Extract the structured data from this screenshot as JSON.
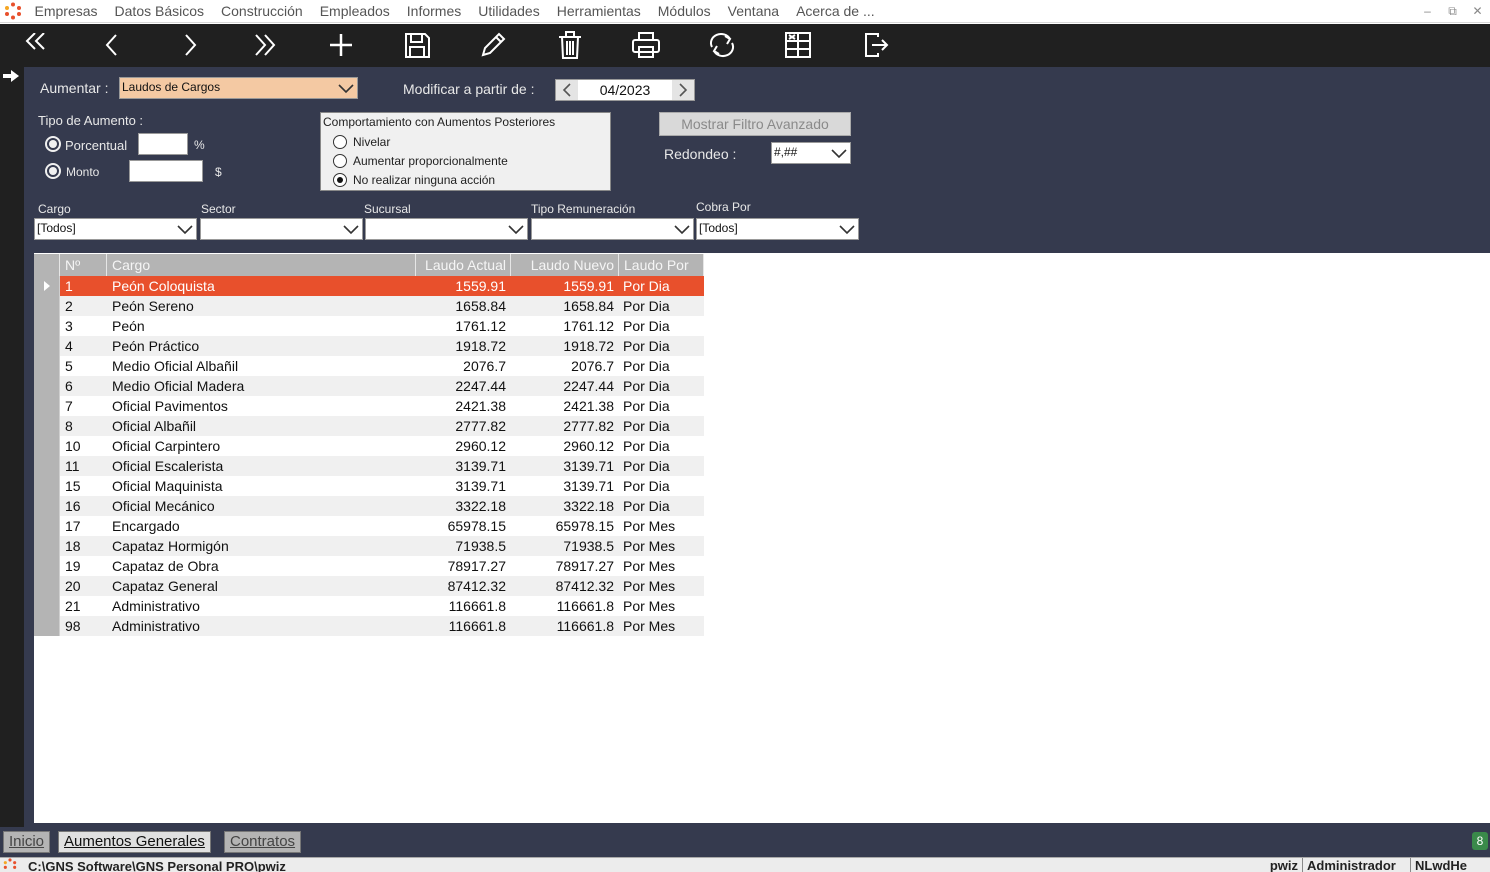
{
  "menu": {
    "items": [
      "Empresas",
      "Datos Básicos",
      "Construcción",
      "Empleados",
      "Informes",
      "Utilidades",
      "Herramientas",
      "Módulos",
      "Ventana",
      "Acerca de ..."
    ]
  },
  "toolbar": {
    "buttons": [
      "first-icon",
      "prev-icon",
      "next-icon",
      "last-icon",
      "add-icon",
      "save-icon",
      "edit-icon",
      "delete-icon",
      "print-icon",
      "refresh-icon",
      "excel-icon",
      "exit-icon"
    ]
  },
  "filters": {
    "aumentar_label": "Aumentar :",
    "aumentar_value": "Laudos de Cargos",
    "modificar_label": "Modificar a partir de :",
    "modificar_value": "04/2023",
    "tipo_label": "Tipo de Aumento :",
    "porcentual_label": "Porcentual",
    "porcentual_unit": "%",
    "monto_label": "Monto",
    "monto_unit": "$",
    "comportamiento_title": "Comportamiento con Aumentos Posteriores",
    "comportamiento_options": [
      "Nivelar",
      "Aumentar proporcionalmente",
      "No realizar ninguna acción"
    ],
    "comportamiento_selected": 2,
    "filtro_button": "Mostrar Filtro Avanzado",
    "redondeo_label": "Redondeo :",
    "redondeo_value": "#,##",
    "cargo_label": "Cargo",
    "cargo_value": "[Todos]",
    "sector_label": "Sector",
    "sector_value": "",
    "sucursal_label": "Sucursal",
    "sucursal_value": "",
    "tipo_rem_label": "Tipo Remuneración",
    "tipo_rem_value": "",
    "cobra_label": "Cobra Por",
    "cobra_value": "[Todos]"
  },
  "table": {
    "columns": [
      "Nº",
      "Cargo",
      "Laudo Actual",
      "Laudo Nuevo",
      "Laudo Por"
    ],
    "rows": [
      {
        "n": "1",
        "cargo": "Peón Coloquista",
        "actual": "1559.91",
        "nuevo": "1559.91",
        "por": "Por Dia"
      },
      {
        "n": "2",
        "cargo": "Peón Sereno",
        "actual": "1658.84",
        "nuevo": "1658.84",
        "por": "Por Dia"
      },
      {
        "n": "3",
        "cargo": "Peón",
        "actual": "1761.12",
        "nuevo": "1761.12",
        "por": "Por Dia"
      },
      {
        "n": "4",
        "cargo": "Peón Práctico",
        "actual": "1918.72",
        "nuevo": "1918.72",
        "por": "Por Dia"
      },
      {
        "n": "5",
        "cargo": "Medio Oficial Albañil",
        "actual": "2076.7",
        "nuevo": "2076.7",
        "por": "Por Dia"
      },
      {
        "n": "6",
        "cargo": "Medio Oficial Madera",
        "actual": "2247.44",
        "nuevo": "2247.44",
        "por": "Por Dia"
      },
      {
        "n": "7",
        "cargo": "Oficial Pavimentos",
        "actual": "2421.38",
        "nuevo": "2421.38",
        "por": "Por Dia"
      },
      {
        "n": "8",
        "cargo": "Oficial Albañil",
        "actual": "2777.82",
        "nuevo": "2777.82",
        "por": "Por Dia"
      },
      {
        "n": "10",
        "cargo": "Oficial Carpintero",
        "actual": "2960.12",
        "nuevo": "2960.12",
        "por": "Por Dia"
      },
      {
        "n": "11",
        "cargo": "Oficial Escalerista",
        "actual": "3139.71",
        "nuevo": "3139.71",
        "por": "Por Dia"
      },
      {
        "n": "15",
        "cargo": "Oficial Maquinista",
        "actual": "3139.71",
        "nuevo": "3139.71",
        "por": "Por Dia"
      },
      {
        "n": "16",
        "cargo": "Oficial Mecánico",
        "actual": "3322.18",
        "nuevo": "3322.18",
        "por": "Por Dia"
      },
      {
        "n": "17",
        "cargo": "Encargado",
        "actual": "65978.15",
        "nuevo": "65978.15",
        "por": "Por Mes"
      },
      {
        "n": "18",
        "cargo": "Capataz Hormigón",
        "actual": "71938.5",
        "nuevo": "71938.5",
        "por": "Por Mes"
      },
      {
        "n": "19",
        "cargo": "Capataz de Obra",
        "actual": "78917.27",
        "nuevo": "78917.27",
        "por": "Por Mes"
      },
      {
        "n": "20",
        "cargo": "Capataz General",
        "actual": "87412.32",
        "nuevo": "87412.32",
        "por": "Por Mes"
      },
      {
        "n": "21",
        "cargo": "Administrativo",
        "actual": "116661.8",
        "nuevo": "116661.8",
        "por": "Por Mes"
      },
      {
        "n": "98",
        "cargo": "Administrativo",
        "actual": "116661.8",
        "nuevo": "116661.8",
        "por": "Por Mes"
      }
    ],
    "selected_row": 0
  },
  "tabs": {
    "items": [
      "Inicio",
      "Aumentos Generales",
      "Contratos"
    ],
    "active": 1,
    "badge": "8"
  },
  "status": {
    "path": "C:\\GNS Software\\GNS Personal PRO\\pwiz",
    "user_db": "pwiz",
    "user": "Administrador",
    "code": "NLwdHe"
  },
  "colors": {
    "accent": "#e8502c",
    "panel": "#353a4e",
    "toolbar": "#202020"
  }
}
